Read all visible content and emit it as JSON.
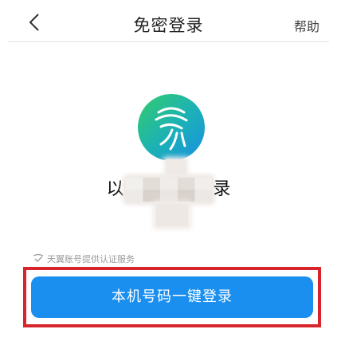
{
  "header": {
    "back_icon": "chevron-left-icon",
    "title": "免密登录",
    "help_label": "帮助"
  },
  "logo": {
    "icon": "fingerprint-logo-icon",
    "gradient_colors": [
      "#2ec87a",
      "#1aa6c8",
      "#1a8fe0"
    ]
  },
  "carrier": {
    "prefix": "以",
    "suffix": "录"
  },
  "service_note": {
    "icon": "shield-check-icon",
    "text": "天翼账号提供认证服务"
  },
  "login_button": {
    "label": "本机号码一键登录",
    "color": "#1a8ff0"
  },
  "highlight": {
    "color": "#d7252b"
  }
}
